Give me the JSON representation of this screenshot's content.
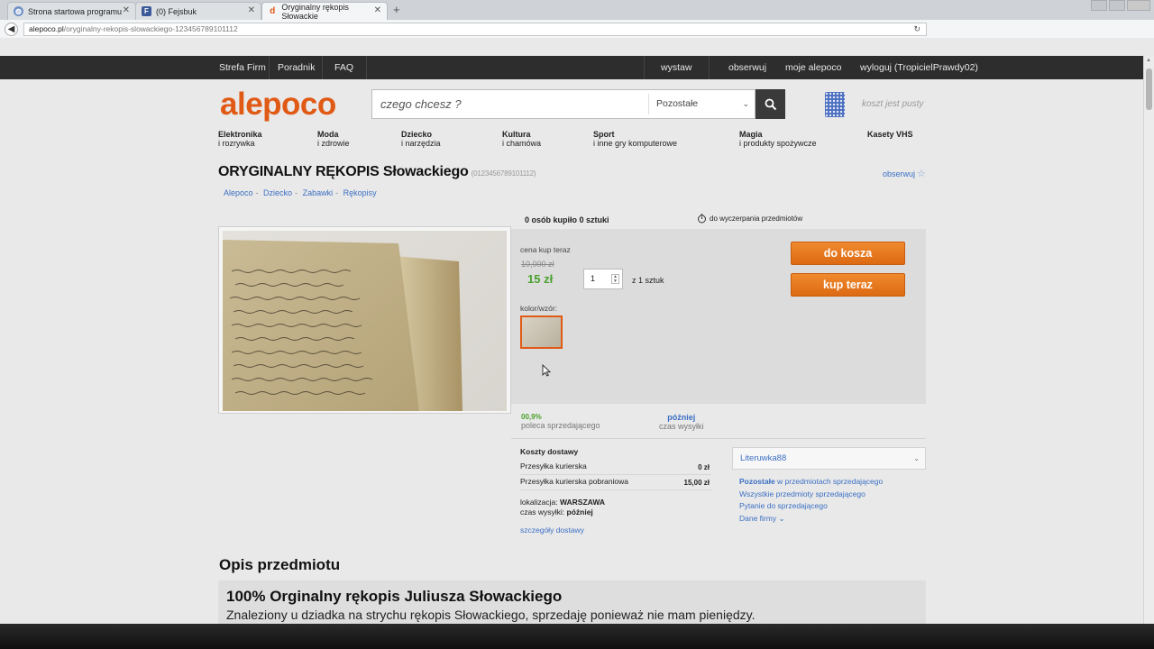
{
  "browser": {
    "tabs": [
      {
        "label": "Strona startowa programu",
        "favicon": "globe-icon",
        "active": false
      },
      {
        "label": "(0) Fejsbuk",
        "favicon": "F",
        "active": false
      },
      {
        "label": "Oryginalny rękopis Słowackie",
        "favicon": "d",
        "active": true
      }
    ],
    "close_glyph": "✕",
    "newtab_glyph": "+",
    "url_domain": "alepoco.pl",
    "url_rest": "/oryginalny-rekopis-slowackiego-123456789101112"
  },
  "topnav": {
    "left": [
      "Strefa Firm",
      "Poradnik",
      "FAQ"
    ],
    "right": [
      "wystaw",
      "obserwuj",
      "moje alepoco",
      "wyloguj (TropicielPrawdy02)"
    ]
  },
  "header": {
    "logo": "alepoco",
    "search_placeholder": "czego chcesz ?",
    "category": "Pozostałe",
    "cart_text": "koszt jest pusty"
  },
  "categories": [
    {
      "line1": "Elektronika",
      "line2": "i rozrywka"
    },
    {
      "line1": "Moda",
      "line2": "i zdrowie"
    },
    {
      "line1": "Dziecko",
      "line2": "i narzędzia"
    },
    {
      "line1": "Kultura",
      "line2": "i chamówa"
    },
    {
      "line1": "Sport",
      "line2": "i inne gry komputerowe"
    },
    {
      "line1": "Magia",
      "line2": "i produkty spożywcze"
    },
    {
      "line1": "Kasety VHS",
      "line2": ""
    }
  ],
  "product": {
    "title": "ORYGINALNY RĘKOPIS Słowackiego",
    "id": "(0123456789101112)",
    "watch": "obserwuj",
    "breadcrumb": [
      "Alepoco",
      "Dziecko",
      "Zabawki",
      "Rękopisy"
    ],
    "buy_stats_prefix": "0 osób",
    "buy_stats_mid": "kupiło",
    "buy_stats_suffix": "0 sztuki",
    "timer_text": "do wyczerpania przedmiotów",
    "price_label": "cena kup teraz",
    "old_price": "10,000 zł",
    "new_price": "15 zł",
    "quantity": "1",
    "qty_of": "z 1 sztuk",
    "color_label": "kolor/wzór:",
    "btn_cart": "do kosza",
    "btn_buy": "kup teraz",
    "seller_rating": "00,9%",
    "seller_rating_label": "poleca sprzedającego",
    "send_time": "później",
    "send_time_label": "czas wysyłki"
  },
  "shipping": {
    "heading": "Koszty dostawy",
    "rows": [
      {
        "label": "Przesyłka kurierska",
        "amount": "0 zł"
      },
      {
        "label": "Przesyłka kurierska pobraniowa",
        "amount": "15,00 zł"
      }
    ],
    "location_label": "lokalizacja:",
    "location": "WARSZAWA",
    "send_label": "czas wysyłki:",
    "send_value": "później",
    "details": "szczegóły dostawy"
  },
  "seller": {
    "name": "Literuwka88",
    "links_0_bold": "Pozostałe",
    "links_0_rest": " w przedmiotach sprzedającego",
    "link_1": "Wszystkie przedmioty sprzedającego",
    "link_2": "Pytanie do sprzedającego",
    "link_3": "Dane firmy"
  },
  "description": {
    "heading": "Opis przedmiotu",
    "title": "100% Orginalny rękopis Juliusza Słowackiego",
    "text": "Znaleziony u dziadka na strychu rękopis Słowackiego, sprzedaję ponieważ nie mam pieniędzy."
  },
  "colors": {
    "accent_orange": "#e05a16",
    "link_blue": "#3b6fc4",
    "price_green": "#4aa12e",
    "nav_dark": "#2d2d2d"
  }
}
